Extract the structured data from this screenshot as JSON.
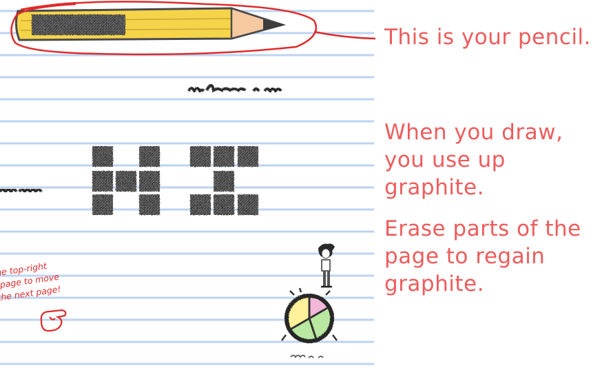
{
  "tutorial": {
    "pencil_tip": "This is your pencil.",
    "graphite_tip": "When you draw, you use up graphite.",
    "erase_tip": "Erase parts of the page to regain graphite."
  },
  "page_note": {
    "lines": [
      "the top-right",
      "page to move",
      "the next page!"
    ]
  },
  "pencil": {
    "graphite_level": 0.92
  },
  "colors": {
    "paper_line": "#bcd3f2",
    "red_ink": "#e02a2a",
    "tip_text": "#ee5b5b",
    "pencil_body": "#f6d44a",
    "graphite": "#444444",
    "ring_segments": [
      "#f3b8d9",
      "#fff09a",
      "#b9e8a0"
    ]
  },
  "icons": {
    "pencil": "pencil-icon",
    "hand": "pointing-hand-icon",
    "ring": "action-ring-icon",
    "player": "stick-figure-icon"
  }
}
